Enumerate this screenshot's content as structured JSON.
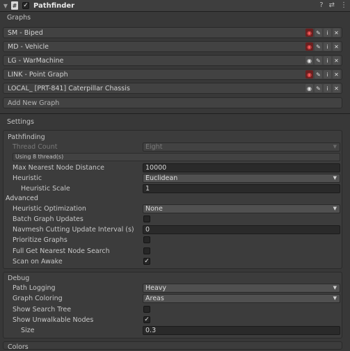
{
  "header": {
    "component_icon": "#",
    "enabled": true,
    "title": "Pathfinder"
  },
  "graphs": {
    "label": "Graphs",
    "items": [
      {
        "name": "SM - Biped",
        "visible": false
      },
      {
        "name": "MD - Vehicle",
        "visible": false
      },
      {
        "name": "LG - WarMachine",
        "visible": true
      },
      {
        "name": "LINK - Point Graph",
        "visible": false
      },
      {
        "name": "LOCAL_ [PRT-841] Caterpillar Chassis",
        "visible": true
      }
    ],
    "add_label": "Add New Graph"
  },
  "settings": {
    "label": "Settings",
    "pathfinding": {
      "title": "Pathfinding",
      "thread_count_label": "Thread Count",
      "thread_count_value": "Eight",
      "thread_info": "Using 8 thread(s)",
      "max_nearest_label": "Max Nearest Node Distance",
      "max_nearest_value": "10000",
      "heuristic_label": "Heuristic",
      "heuristic_value": "Euclidean",
      "heuristic_scale_label": "Heuristic Scale",
      "heuristic_scale_value": "1"
    },
    "advanced": {
      "title": "Advanced",
      "heuristic_opt_label": "Heuristic Optimization",
      "heuristic_opt_value": "None",
      "batch_label": "Batch Graph Updates",
      "batch_checked": false,
      "navmesh_label": "Navmesh Cutting Update Interval (s)",
      "navmesh_value": "0",
      "prioritize_label": "Prioritize Graphs",
      "prioritize_checked": false,
      "full_get_label": "Full Get Nearest Node Search",
      "full_get_checked": false,
      "scan_label": "Scan on Awake",
      "scan_checked": true
    },
    "debug": {
      "title": "Debug",
      "path_logging_label": "Path Logging",
      "path_logging_value": "Heavy",
      "graph_coloring_label": "Graph Coloring",
      "graph_coloring_value": "Areas",
      "search_tree_label": "Show Search Tree",
      "search_tree_checked": false,
      "unwalkable_label": "Show Unwalkable Nodes",
      "unwalkable_checked": true,
      "size_label": "Size",
      "size_value": "0.3"
    },
    "colors_label": "Colors"
  },
  "icons": {
    "fold": "triangle-down",
    "help": "question-circle",
    "presets": "sliders",
    "menu": "kebab",
    "eye": "eye",
    "pencil": "pencil",
    "info": "info",
    "close": "x"
  },
  "colors": {
    "eye_off_bg": "#6a2020",
    "eye_off_fg": "#ff5a5a"
  }
}
